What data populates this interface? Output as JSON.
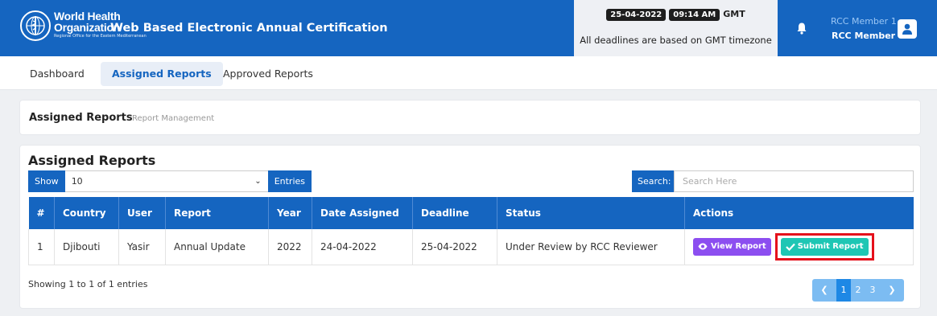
{
  "header": {
    "org_line1": "World Health",
    "org_line2": "Organization",
    "org_sub": "Regional Office for the Eastern Mediterranean",
    "app_title": "Web Based Electronic Annual Certification",
    "date": "25-04-2022",
    "time": "09:14 AM",
    "timezone": "GMT",
    "deadline_note": "All deadlines are based on GMT timezone",
    "user_name": "RCC Member 1",
    "user_role": "RCC Member",
    "colors": {
      "primary": "#1565c0",
      "deadline_box": "#eef0f4"
    }
  },
  "nav": {
    "items": [
      {
        "label": "Dashboard",
        "active": false
      },
      {
        "label": "Assigned Reports",
        "active": true
      },
      {
        "label": "Approved Reports",
        "active": false
      }
    ]
  },
  "breadcrumb": {
    "title": "Assigned Reports",
    "subtitle": "Report Management"
  },
  "main": {
    "title": "Assigned Reports",
    "show_label": "Show",
    "show_value": "10",
    "entries_label": "Entries",
    "search_label": "Search:",
    "search_placeholder": "Search Here",
    "columns": [
      "#",
      "Country",
      "User",
      "Report",
      "Year",
      "Date Assigned",
      "Deadline",
      "Status",
      "Actions"
    ],
    "rows": [
      {
        "num": "1",
        "country": "Djibouti",
        "user": "Yasir",
        "report": "Annual Update",
        "year": "2022",
        "date_assigned": "24-04-2022",
        "deadline": "25-04-2022",
        "status": "Under Review by RCC Reviewer",
        "view_label": "View Report",
        "submit_label": "Submit Report"
      }
    ],
    "showing_text": "Showing 1 to 1 of 1 entries",
    "pagination": {
      "pages": [
        "1",
        "2",
        "3"
      ],
      "current": "1",
      "prev_icon": "chevron-left-icon",
      "next_icon": "chevron-right-icon"
    },
    "colors": {
      "view_button": "#8c4ef0",
      "submit_button": "#1ec6b4",
      "highlight": "#e5101b"
    }
  }
}
